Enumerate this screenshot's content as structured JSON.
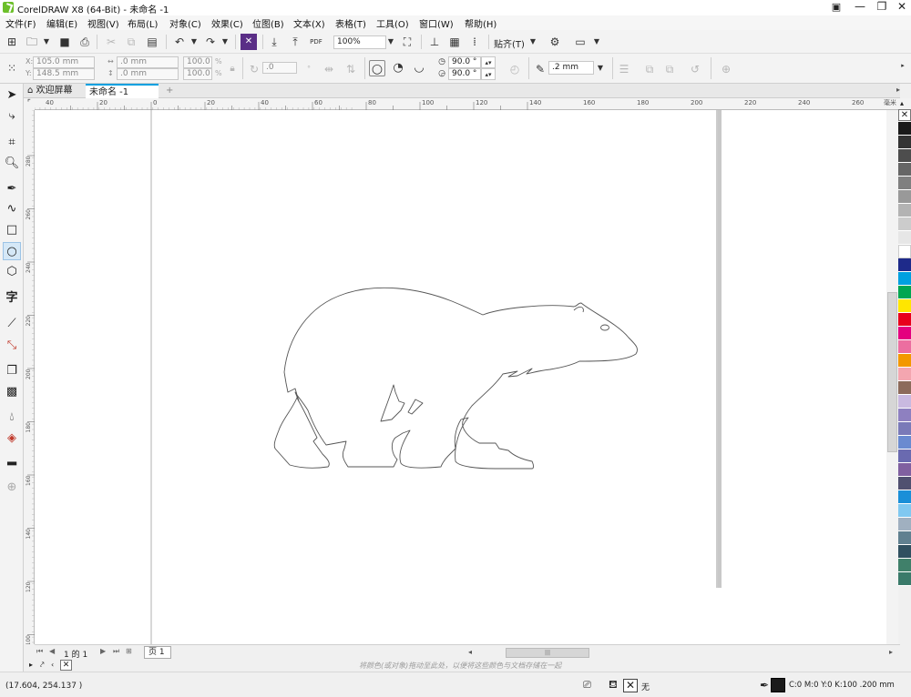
{
  "window": {
    "title": "CorelDRAW X8 (64-Bit) - 未命名 -1",
    "controls": {
      "minimize": "—",
      "restore": "❐",
      "close": "✕"
    }
  },
  "menu": [
    "文件(F)",
    "编辑(E)",
    "视图(V)",
    "布局(L)",
    "对象(C)",
    "效果(C)",
    "位图(B)",
    "文本(X)",
    "表格(T)",
    "工具(O)",
    "窗口(W)",
    "帮助(H)"
  ],
  "toolbar": {
    "zoom_value": "100%",
    "snap_label": "贴齐(T)",
    "pdf_label": "PDF"
  },
  "propertybar": {
    "x": "105.0 mm",
    "y": "148.5 mm",
    "width": ".0 mm",
    "height": ".0 mm",
    "scale_w": "100.0",
    "scale_h": "100.0",
    "percent": "%",
    "rotation": ".0",
    "start_angle": "90.0 °",
    "end_angle": "90.0 °",
    "outline_width": ".2 mm"
  },
  "tabs": {
    "welcome": "欢迎屏幕",
    "document": "未命名 -1",
    "add": "+"
  },
  "ruler": {
    "h_labels": [
      "40",
      "20",
      "0",
      "20",
      "40",
      "60",
      "80",
      "100",
      "120",
      "140",
      "160",
      "180",
      "200",
      "220",
      "240",
      "260",
      "毫米"
    ],
    "v_labels": [
      "280",
      "260",
      "240",
      "220",
      "200",
      "180",
      "160",
      "140",
      "120",
      "100",
      "80"
    ]
  },
  "pagebar": {
    "page_count_label": "1 的 1",
    "page_tab": "页 1"
  },
  "hint": "将颜色(或对象)拖动至此处，以便将这些颜色与文档存储在一起",
  "status": {
    "coords": "(17.604, 254.137 )",
    "fill_none": "无",
    "color_info": "C:0 M:0 Y:0 K:100  .200 mm"
  },
  "palette_colors": [
    "#1a1a1a",
    "#333333",
    "#4d4d4d",
    "#666666",
    "#808080",
    "#999999",
    "#b3b3b3",
    "#cccccc",
    "#e6e6e6",
    "#ffffff",
    "#1e2a8a",
    "#00a0e0",
    "#00a651",
    "#ffe600",
    "#e8001c",
    "#e4007f",
    "#ec6ea0",
    "#f39800",
    "#f4a6b0",
    "#8c6a5a",
    "#c9b9e0",
    "#8e80c0",
    "#7a7ab8",
    "#6a8ad0",
    "#6a6ab0",
    "#8060a0",
    "#505070",
    "#1a8fd8",
    "#80c8f0",
    "#a0b0c0",
    "#608090",
    "#305060",
    "#40806a",
    "#3a7a6a"
  ],
  "colors": {
    "accent": "#00a0e0",
    "page_border": "#9a9a9a",
    "outline": "#555555"
  }
}
